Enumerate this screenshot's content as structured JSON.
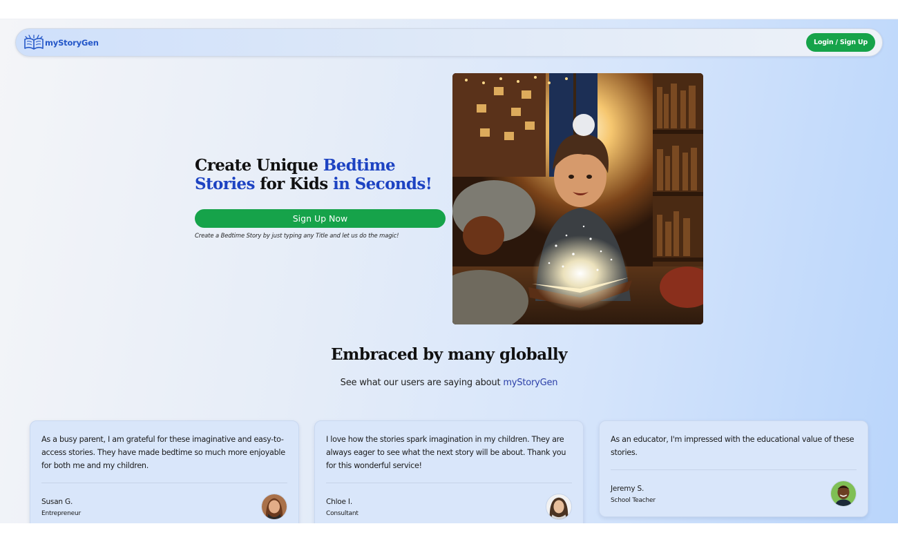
{
  "header": {
    "brand_name": "myStoryGen",
    "logo_icon": "open-book-icon",
    "login_label": "Login / Sign Up"
  },
  "hero": {
    "title_parts": [
      "Create Unique ",
      "Bedtime",
      " ",
      "Stories",
      " for Kids ",
      "in Seconds!"
    ],
    "cta_label": "Sign Up Now",
    "caption": "Create a Bedtime Story by just typing any Title and let us do the magic!",
    "image": "boy-reading-glowing-book-illustration"
  },
  "testimonials": {
    "title": "Embraced by many globally",
    "subtitle_prefix": "See what our users are saying about ",
    "subtitle_brand": "myStoryGen",
    "items": [
      {
        "quote": "As a busy parent, I am grateful for these imaginative and easy-to-access stories. They have made bedtime so much more enjoyable for both me and my children.",
        "name": "Susan G.",
        "role": "Entrepreneur",
        "avatar": "woman-portrait-avatar"
      },
      {
        "quote": "I love how the stories spark imagination in my children. They are always eager to see what the next story will be about. Thank you for this wonderful service!",
        "name": "Chloe I.",
        "role": "Consultant",
        "avatar": "woman-portrait-avatar"
      },
      {
        "quote": "As an educator, I'm impressed with the educational value of these stories.",
        "name": "Jeremy S.",
        "role": "School Teacher",
        "avatar": "man-portrait-avatar"
      }
    ]
  },
  "colors": {
    "accent_green": "#16a34a",
    "brand_blue": "#1d43c2",
    "card_bg": "#d9e6fa"
  }
}
